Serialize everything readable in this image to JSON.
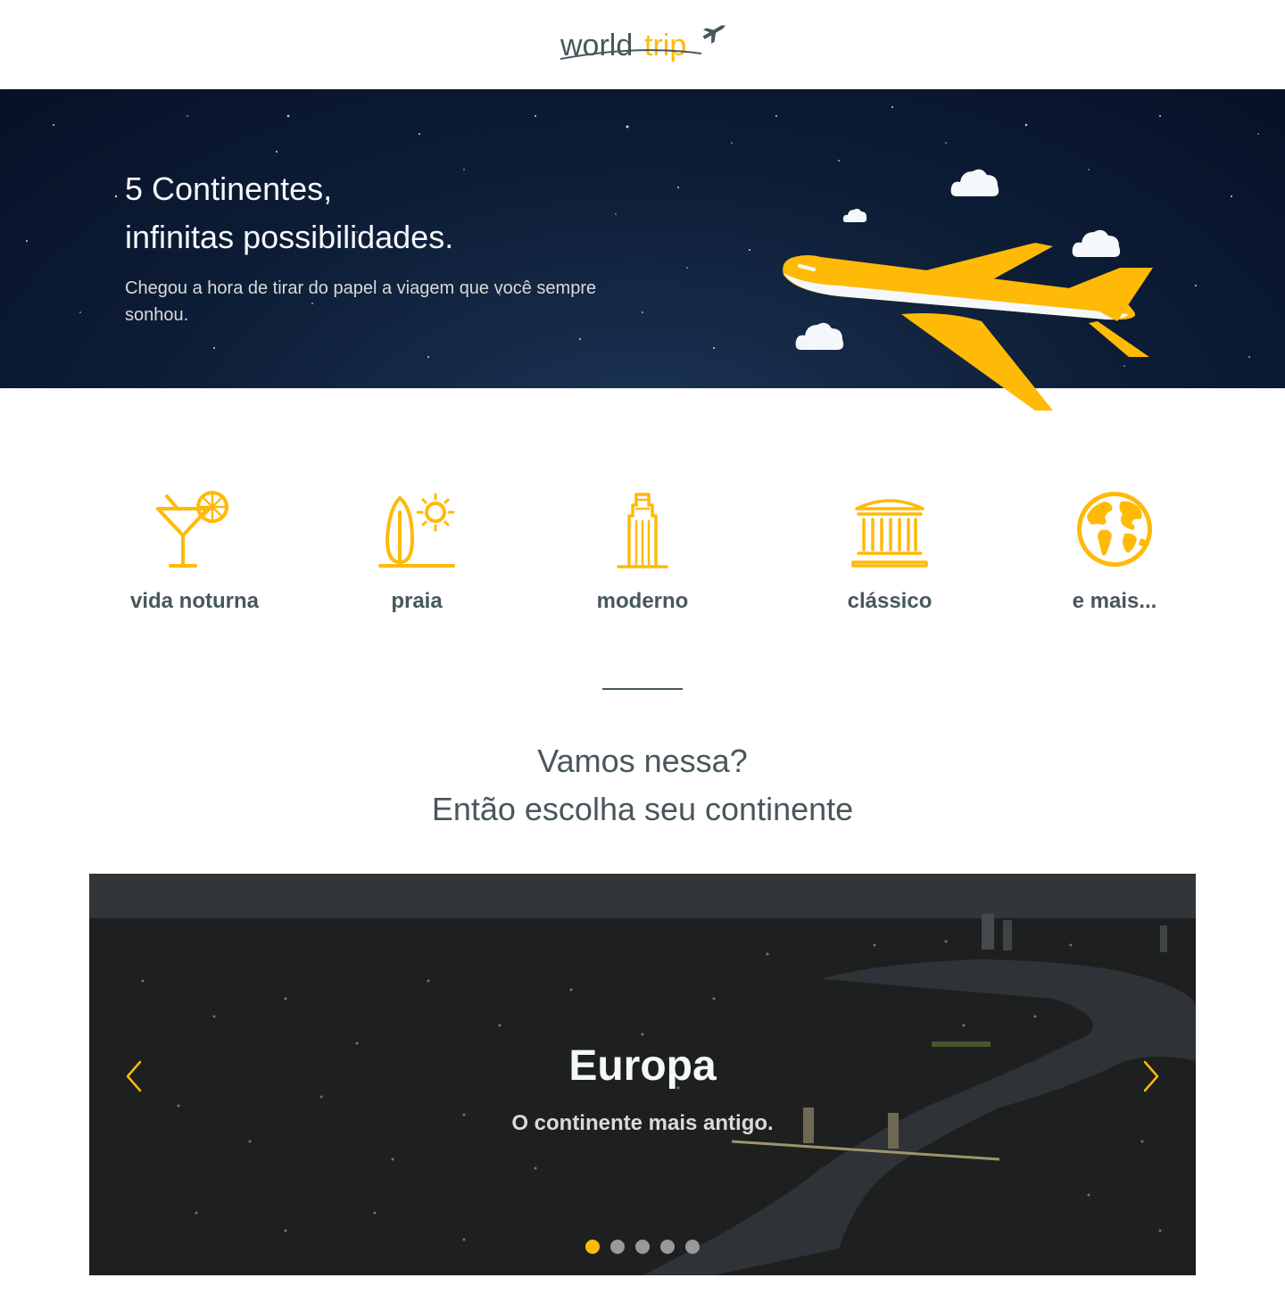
{
  "header": {
    "logo_text_world": "world",
    "logo_text_trip": "trip",
    "logo_icon": "airplane-icon"
  },
  "banner": {
    "title": "5 Continentes,\ninfinitas possibilidades.",
    "subtitle": "Chegou a hora de tirar do papel a viagem que você sempre sonhou."
  },
  "travel_types": [
    {
      "label": "vida noturna",
      "icon": "cocktail-icon"
    },
    {
      "label": "praia",
      "icon": "surfboard-sun-icon"
    },
    {
      "label": "moderno",
      "icon": "skyscraper-icon"
    },
    {
      "label": "clássico",
      "icon": "museum-icon"
    },
    {
      "label": "e mais...",
      "icon": "globe-icon"
    }
  ],
  "cta": {
    "line1": "Vamos nessa?",
    "line2": "Então escolha seu continente"
  },
  "carousel": {
    "title": "Europa",
    "subtitle": "O continente mais antigo.",
    "slide_count": 5,
    "active_index": 0
  },
  "colors": {
    "highlight": "#FFBA08",
    "dark_text": "#47585B",
    "light_text": "#F5F8FA",
    "info": "#DADADA"
  }
}
